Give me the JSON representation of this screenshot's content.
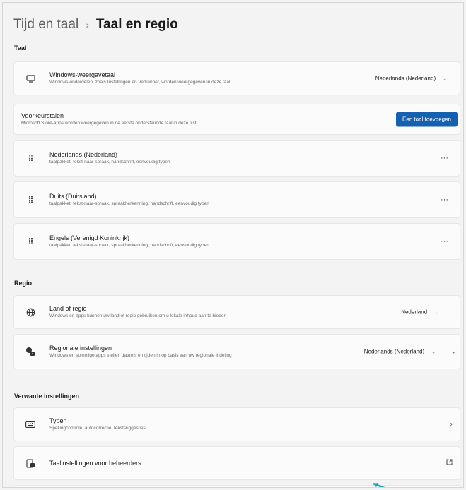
{
  "breadcrumb": {
    "parent": "Tijd en taal",
    "separator": "›",
    "current": "Taal en regio"
  },
  "sections": {
    "taal": "Taal",
    "regio": "Regio",
    "verwante": "Verwante instellingen"
  },
  "display_language": {
    "icon": "monitor-icon",
    "title": "Windows-weergavetaal",
    "desc": "Windows-onderdelen, zoals Instellingen en Verkenner, worden weergegeven in deze taal.",
    "value": "Nederlands (Nederland)"
  },
  "preferred": {
    "title": "Voorkeurstalen",
    "desc": "Microsoft Store-apps worden weergegeven in de eerste ondersteunde taal in deze lijst",
    "button": "Een taal toevoegen"
  },
  "languages": [
    {
      "title": "Nederlands (Nederland)",
      "desc": "taalpakket, tekst-naar-spraak, handschrift, eenvoudig typen"
    },
    {
      "title": "Duits (Duitsland)",
      "desc": "taalpakket, tekst-naar-spraak, spraakherkenning, handschrift, eenvoudig typen"
    },
    {
      "title": "Engels (Verenigd Koninkrijk)",
      "desc": "taalpakket, tekst-naar-spraak, spraakherkenning, handschrift, eenvoudig typen"
    }
  ],
  "more_glyph": "···",
  "grip_glyph": "⁞⁞",
  "country": {
    "icon": "globe-icon",
    "title": "Land of regio",
    "desc": "Windows en apps kunnen uw land of regio gebruiken om u lokale inhoud aan te bieden",
    "value": "Nederland"
  },
  "regional_format": {
    "icon": "regional-format-icon",
    "title": "Regionale instellingen",
    "desc": "Windows en sommige apps stellen datums en tijden in op basis van uw regionale indeling",
    "value": "Nederlands (Nederland)"
  },
  "typing": {
    "icon": "keyboard-icon",
    "title": "Typen",
    "desc": "Spellingcontrole, autocorrectie, tekstsuggesties"
  },
  "admin": {
    "icon": "admin-language-icon",
    "title": "Taalinstellingen voor beheerders"
  }
}
